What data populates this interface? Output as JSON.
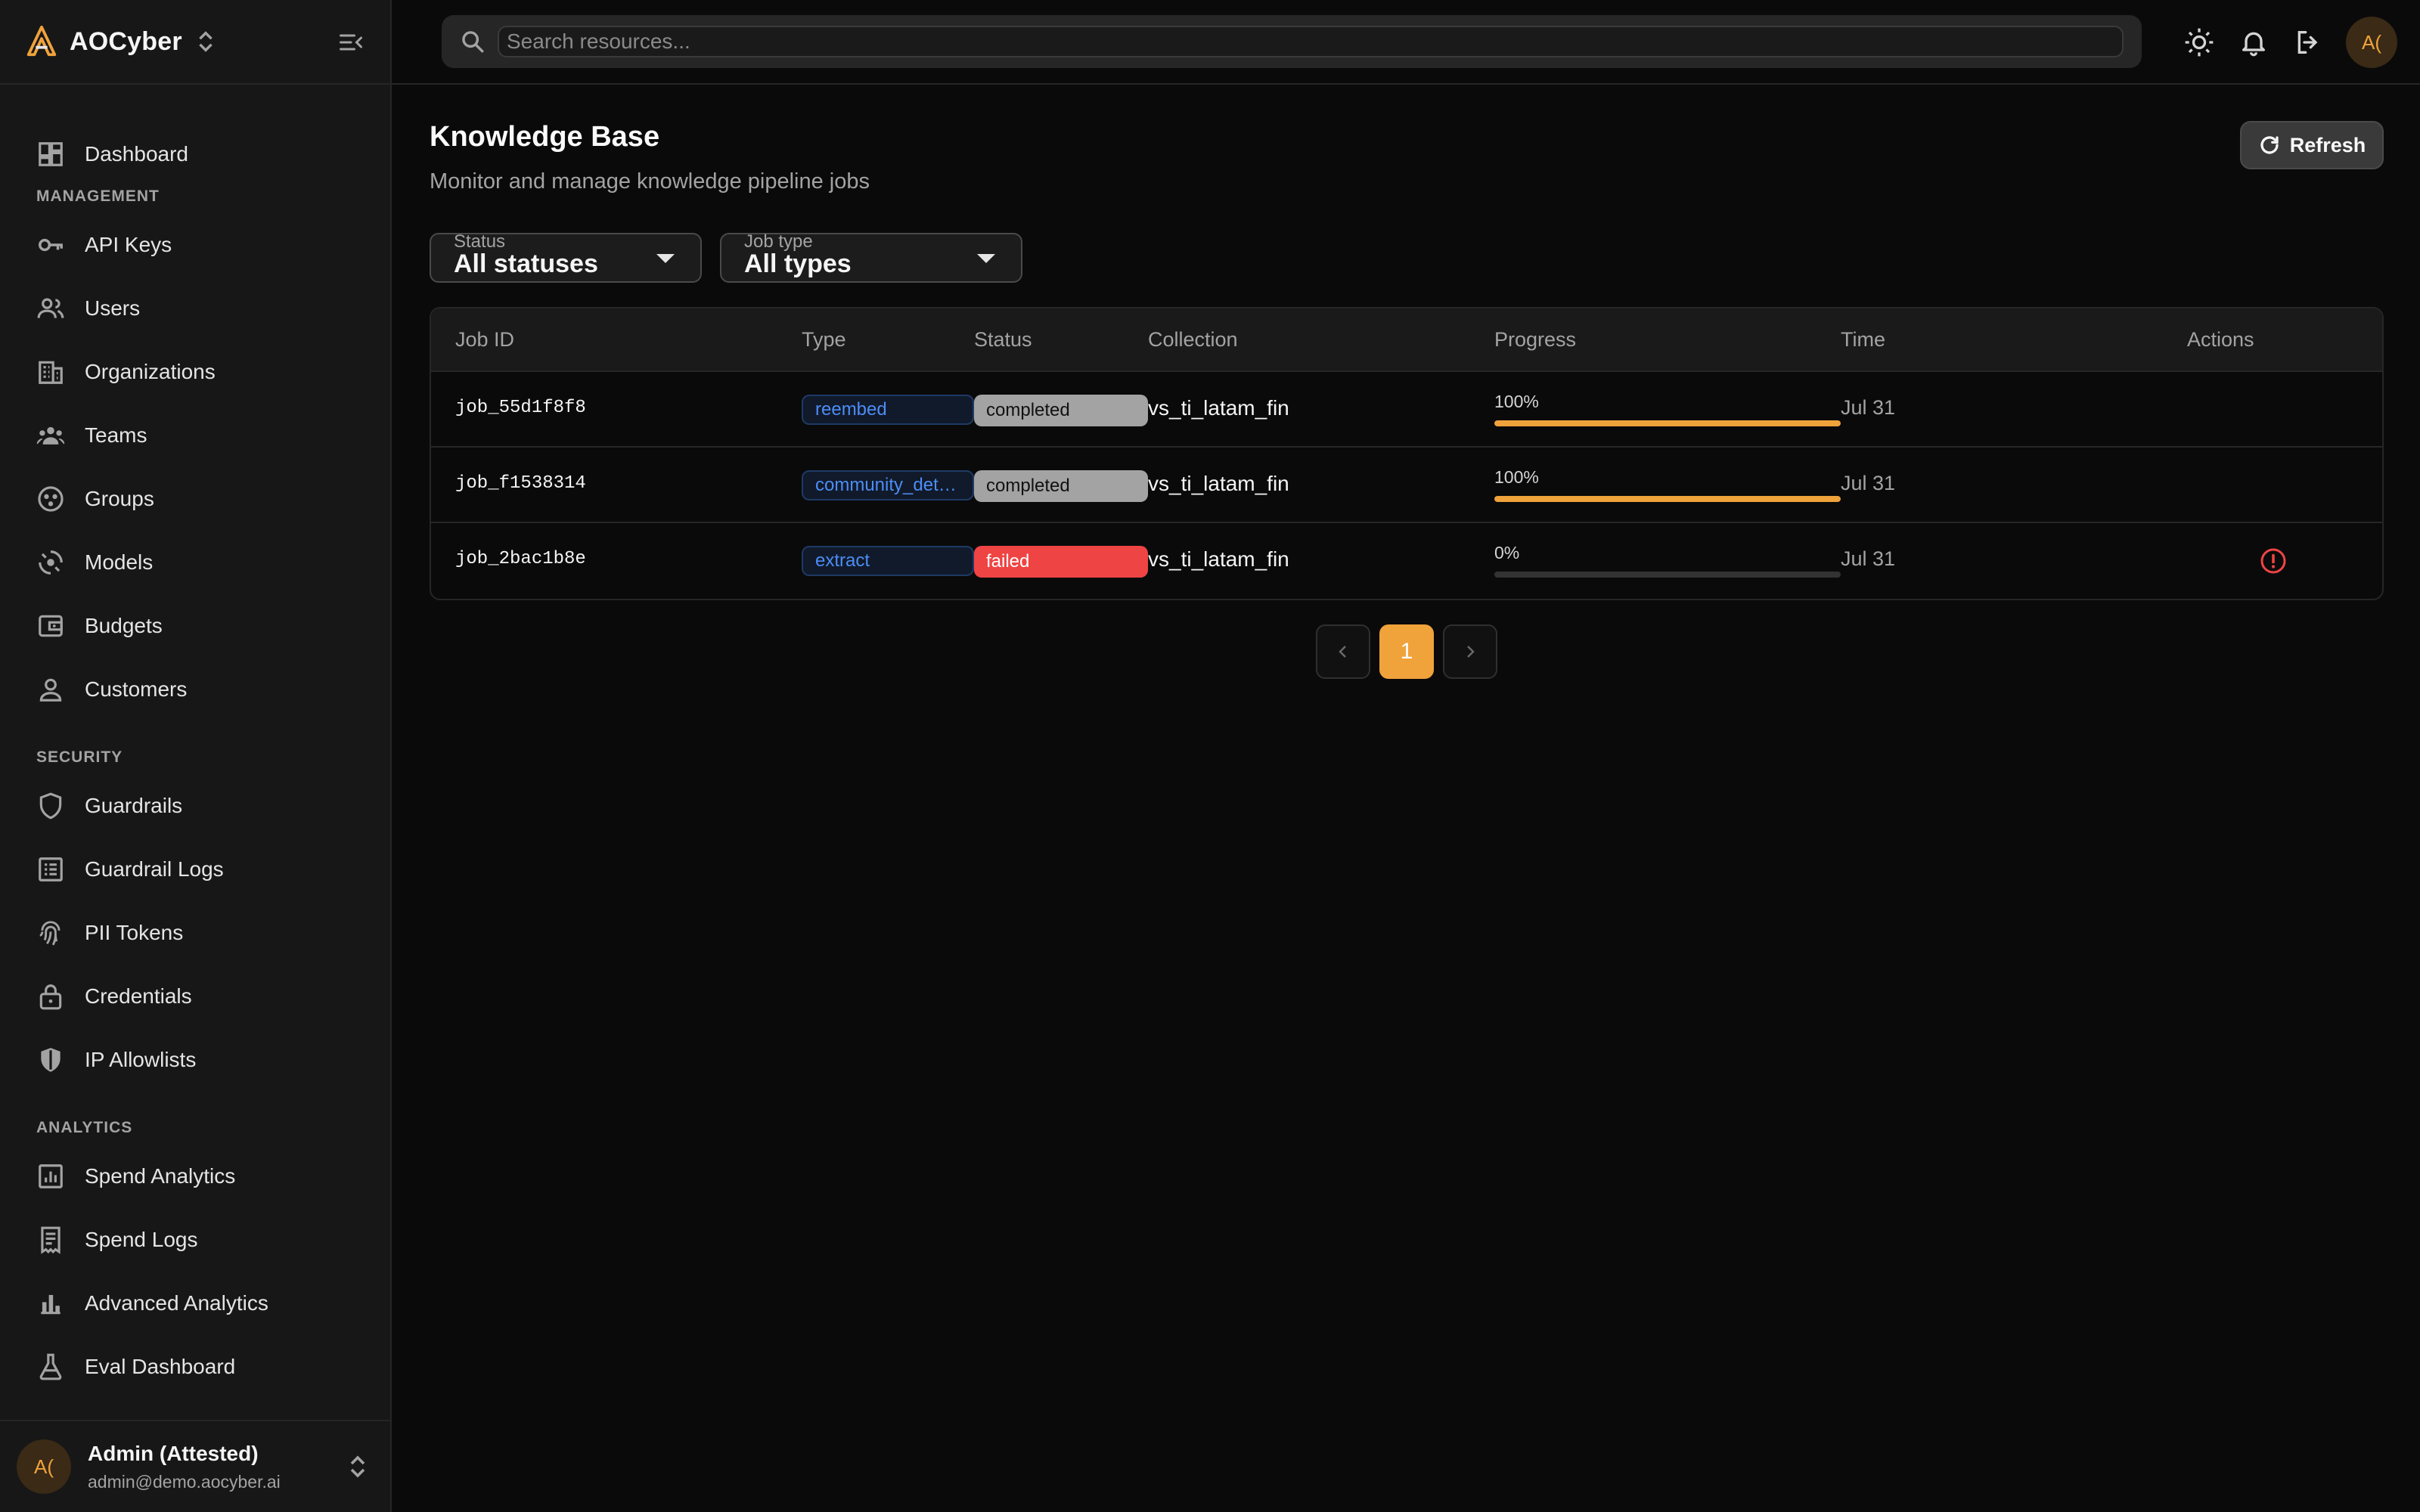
{
  "brand": {
    "name": "AOCyber"
  },
  "search": {
    "placeholder": "Search resources..."
  },
  "topbar": {
    "avatar_initials": "A("
  },
  "sidebar": {
    "dashboard": "Dashboard",
    "sections": {
      "management": "MANAGEMENT",
      "security": "SECURITY",
      "analytics": "ANALYTICS"
    },
    "items": {
      "api_keys": "API Keys",
      "users": "Users",
      "organizations": "Organizations",
      "teams": "Teams",
      "groups": "Groups",
      "models": "Models",
      "budgets": "Budgets",
      "customers": "Customers",
      "guardrails": "Guardrails",
      "guardrail_logs": "Guardrail Logs",
      "pii_tokens": "PII Tokens",
      "credentials": "Credentials",
      "ip_allowlists": "IP Allowlists",
      "spend_analytics": "Spend Analytics",
      "spend_logs": "Spend Logs",
      "advanced_analytics": "Advanced Analytics",
      "eval_dashboard": "Eval Dashboard"
    },
    "user": {
      "initials": "A(",
      "name": "Admin (Attested)",
      "email": "admin@demo.aocyber.ai"
    }
  },
  "page": {
    "title": "Knowledge Base",
    "subtitle": "Monitor and manage knowledge pipeline jobs",
    "refresh_label": "Refresh"
  },
  "filters": {
    "status": {
      "label": "Status",
      "value": "All statuses"
    },
    "job_type": {
      "label": "Job type",
      "value": "All types"
    }
  },
  "table": {
    "headers": {
      "job_id": "Job ID",
      "type": "Type",
      "status": "Status",
      "collection": "Collection",
      "progress": "Progress",
      "time": "Time",
      "actions": "Actions"
    },
    "rows": [
      {
        "job_id": "job_55d1f8f8",
        "type": "reembed",
        "status": "completed",
        "collection": "vs_ti_latam_fin",
        "progress_text": "100%",
        "progress": 1.0,
        "time": "Jul 31"
      },
      {
        "job_id": "job_f1538314",
        "type": "community_detection",
        "status": "completed",
        "collection": "vs_ti_latam_fin",
        "progress_text": "100%",
        "progress": 1.0,
        "time": "Jul 31"
      },
      {
        "job_id": "job_2bac1b8e",
        "type": "extract",
        "status": "failed",
        "collection": "vs_ti_latam_fin",
        "progress_text": "0%",
        "progress": 0.0,
        "time": "Jul 31"
      }
    ]
  },
  "pagination": {
    "current": "1"
  },
  "colors": {
    "accent": "#f0a23b",
    "failed": "#ef4444",
    "completed": "#a3a3a3",
    "type_badge": "#4c8df6"
  }
}
